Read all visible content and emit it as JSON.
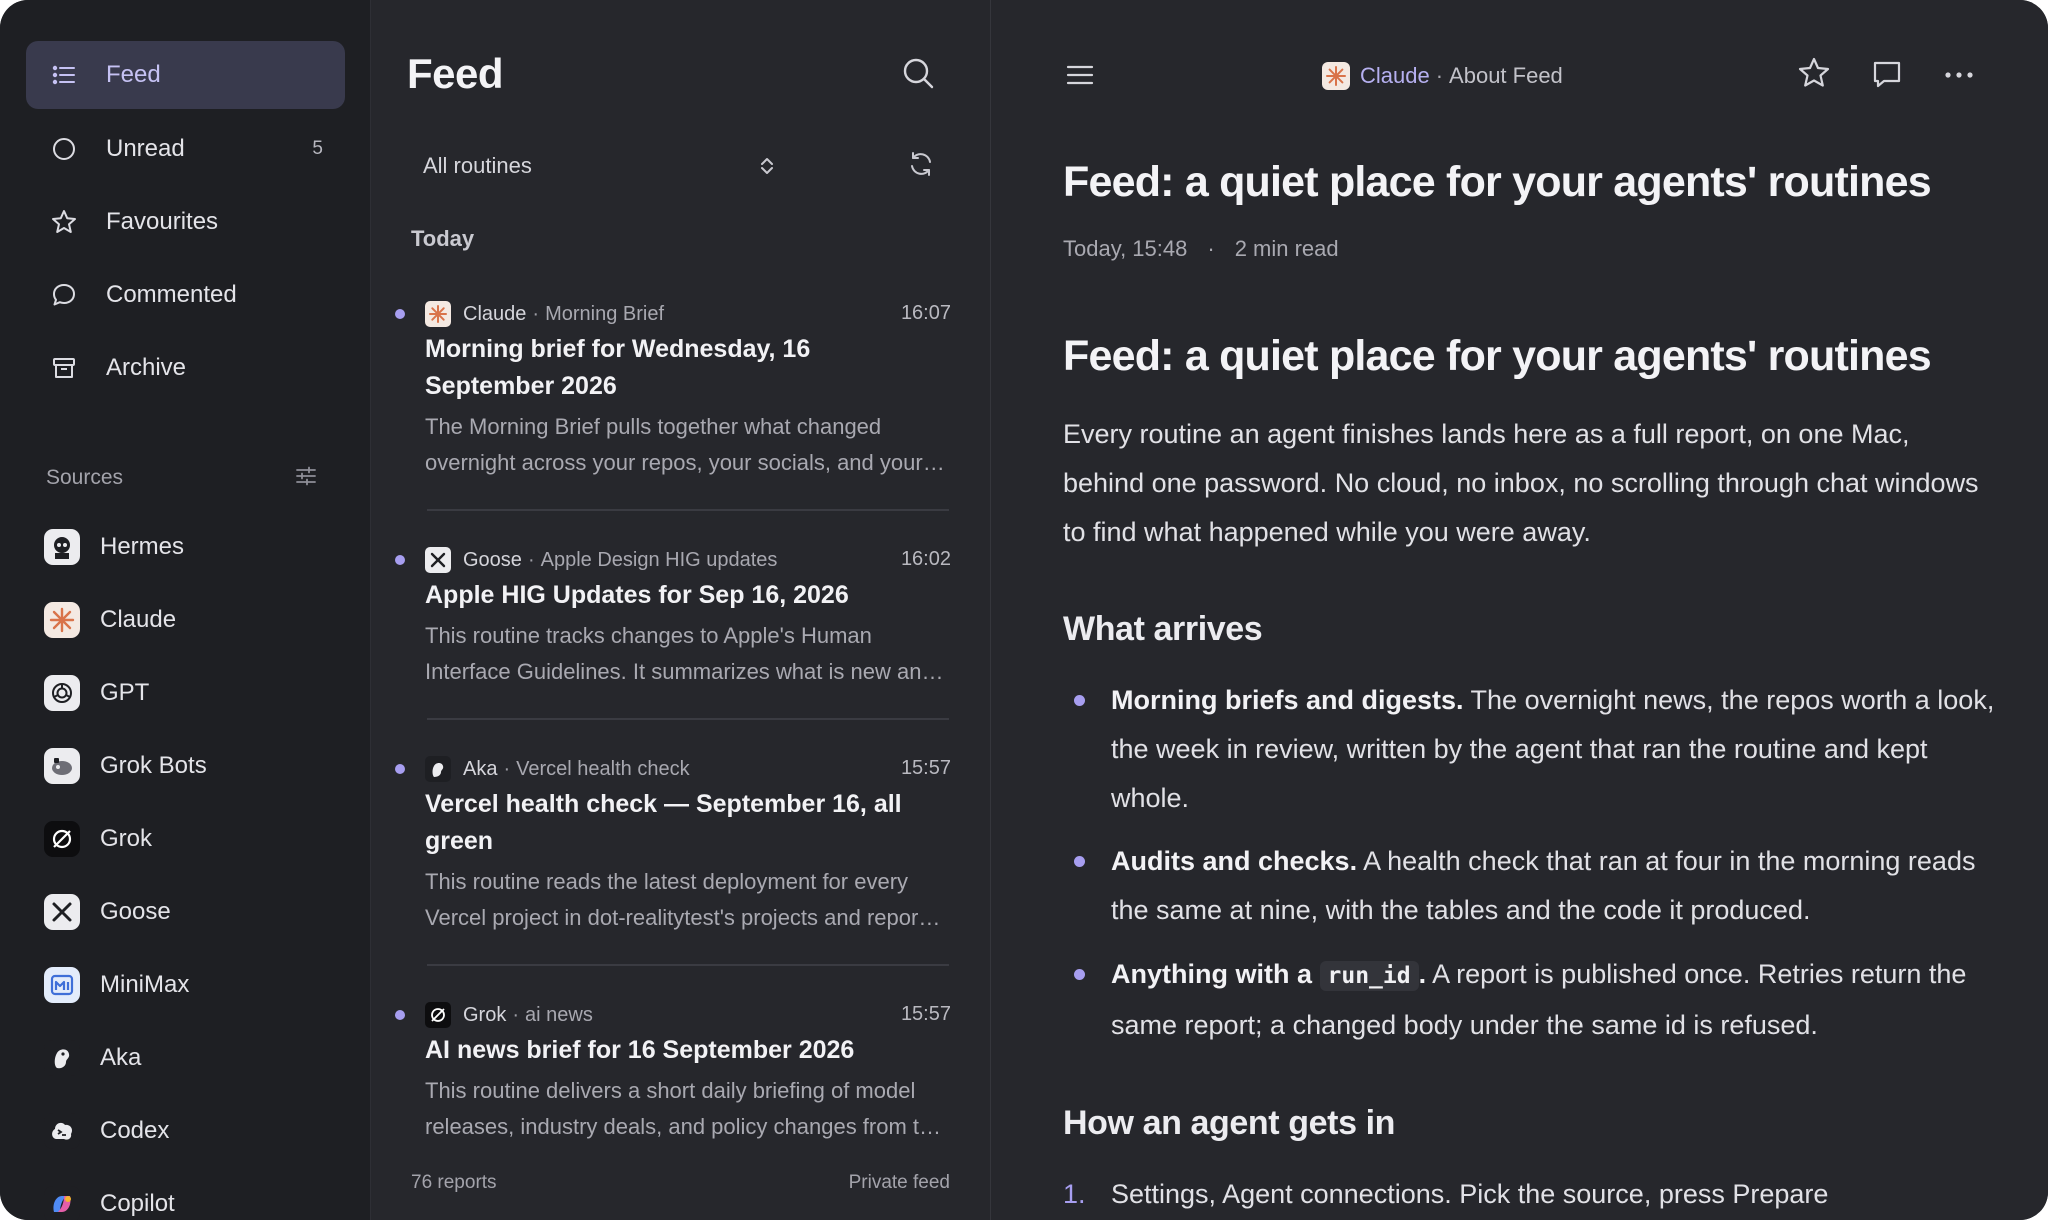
{
  "sidebar": {
    "nav": [
      {
        "label": "Feed",
        "icon": "list-icon",
        "active": true
      },
      {
        "label": "Unread",
        "icon": "circle-icon",
        "count": "5"
      },
      {
        "label": "Favourites",
        "icon": "star-icon"
      },
      {
        "label": "Commented",
        "icon": "comment-icon"
      },
      {
        "label": "Archive",
        "icon": "archive-icon"
      }
    ],
    "sources_title": "Sources",
    "sources": [
      {
        "label": "Hermes",
        "icon": "hermes-icon"
      },
      {
        "label": "Claude",
        "icon": "claude-icon"
      },
      {
        "label": "GPT",
        "icon": "gpt-icon"
      },
      {
        "label": "Grok Bots",
        "icon": "grok-bots-icon"
      },
      {
        "label": "Grok",
        "icon": "grok-icon"
      },
      {
        "label": "Goose",
        "icon": "goose-icon"
      },
      {
        "label": "MiniMax",
        "icon": "minimax-icon"
      },
      {
        "label": "Aka",
        "icon": "aka-icon"
      },
      {
        "label": "Codex",
        "icon": "codex-icon"
      },
      {
        "label": "Copilot",
        "icon": "copilot-icon"
      }
    ]
  },
  "list": {
    "title": "Feed",
    "filter": "All routines",
    "section": "Today",
    "items": [
      {
        "source": "Claude",
        "routine": "Morning Brief",
        "time": "16:07",
        "title": "Morning brief for Wednesday, 16 September 2026",
        "excerpt": "The Morning Brief pulls together what changed overnight across your repos, your socials, and your calendar so you can start the day with context."
      },
      {
        "source": "Goose",
        "routine": "Apple Design HIG updates",
        "time": "16:02",
        "title": "Apple HIG Updates for Sep 16, 2026",
        "excerpt": "This routine tracks changes to Apple's Human Interface Guidelines. It summarizes what is new and what was revised since the last run."
      },
      {
        "source": "Aka",
        "routine": "Vercel health check",
        "time": "15:57",
        "title": "Vercel health check — September 16, all green",
        "excerpt": "This routine reads the latest deployment for every Vercel project in dot-realitytest's projects and reports their status."
      },
      {
        "source": "Grok",
        "routine": "ai news",
        "time": "15:57",
        "title": "AI news brief for 16 September 2026",
        "excerpt": "This routine delivers a short daily briefing of model releases, industry deals, and policy changes from the last day."
      }
    ],
    "footer_count": "76 reports",
    "footer_label": "Private feed"
  },
  "reader": {
    "crumb_source": "Claude",
    "crumb_sep": "·",
    "crumb_page": "About Feed",
    "title": "Feed: a quiet place for your agents' routines",
    "date": "Today, 15:48",
    "meta_dot": "·",
    "read_time": "2 min read",
    "h1": "Feed: a quiet place for your agents' routines",
    "intro": "Every routine an agent finishes lands here as a full report, on one Mac, behind one password. No cloud, no inbox, no scrolling through chat windows to find what happened while you were away.",
    "h2_arrives": "What arrives",
    "bullets": [
      {
        "strong": "Morning briefs and digests.",
        "text": " The overnight news, the repos worth a look, the week in review, written by the agent that ran the routine and kept whole."
      },
      {
        "strong": "Audits and checks.",
        "text": " A health check that ran at four in the morning reads the same at nine, with the tables and the code it produced."
      },
      {
        "strong": "Anything with a ",
        "code": "run_id",
        "strong2": ".",
        "text": " A report is published once. Retries return the same report; a changed body under the same id is refused."
      }
    ],
    "h2_agent": "How an agent gets in",
    "ordered": [
      {
        "num": "1.",
        "text": "Settings, Agent connections. Pick the source, press Prepare"
      }
    ]
  },
  "colors": {
    "accent": "#a79ef0",
    "sidebar_bg": "#1e1f23",
    "panel_bg": "#26272c",
    "active_nav_bg": "#393a4d"
  }
}
